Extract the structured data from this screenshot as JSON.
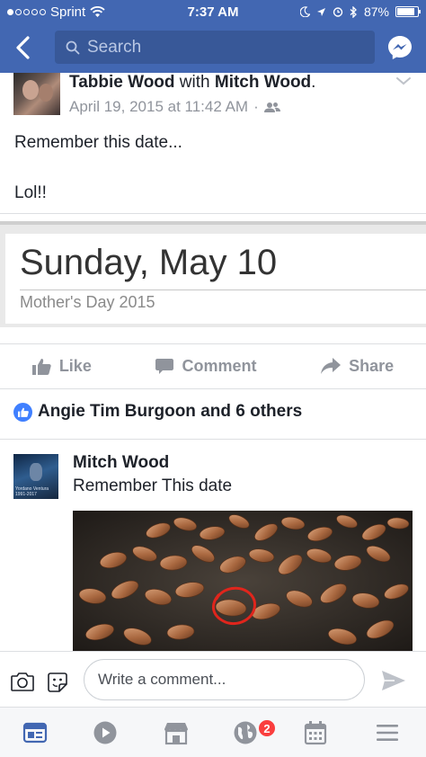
{
  "status_bar": {
    "carrier": "Sprint",
    "time": "7:37 AM",
    "battery_percent": "87%",
    "battery_level": 0.87
  },
  "nav": {
    "search_placeholder": "Search"
  },
  "post": {
    "author": "Tabbie Wood",
    "with_text": "with",
    "tagged": "Mitch Wood",
    "period": ".",
    "timestamp": "April 19, 2015 at 11:42 AM",
    "separator": "·",
    "text_line1": "Remember this date...",
    "text_line2": "Lol!!",
    "card_date": "Sunday, May 10",
    "card_subtitle": "Mother's Day 2015"
  },
  "actions": {
    "like": "Like",
    "comment": "Comment",
    "share": "Share"
  },
  "reactions": {
    "summary": "Angie Tim Burgoon and 6 others"
  },
  "comment": {
    "author": "Mitch Wood",
    "text": "Remember This date",
    "avatar_caption": "Yordano Ventura 1991-2017"
  },
  "composer": {
    "placeholder": "Write a comment..."
  },
  "tabbar": {
    "notifications_badge": "2"
  },
  "colors": {
    "brand": "#4267b2",
    "search_bg": "#385898",
    "like_blue": "#4080ff",
    "badge_red": "#fa3e3e",
    "muted": "#90949c"
  },
  "icons": [
    "back-arrow-icon",
    "search-icon",
    "messenger-icon",
    "chevron-down-icon",
    "friends-audience-icon",
    "like-icon",
    "comment-icon",
    "share-icon",
    "camera-icon",
    "sticker-icon",
    "send-icon",
    "news-feed-icon",
    "video-icon",
    "marketplace-icon",
    "globe-notifications-icon",
    "calendar-icon",
    "menu-icon"
  ]
}
